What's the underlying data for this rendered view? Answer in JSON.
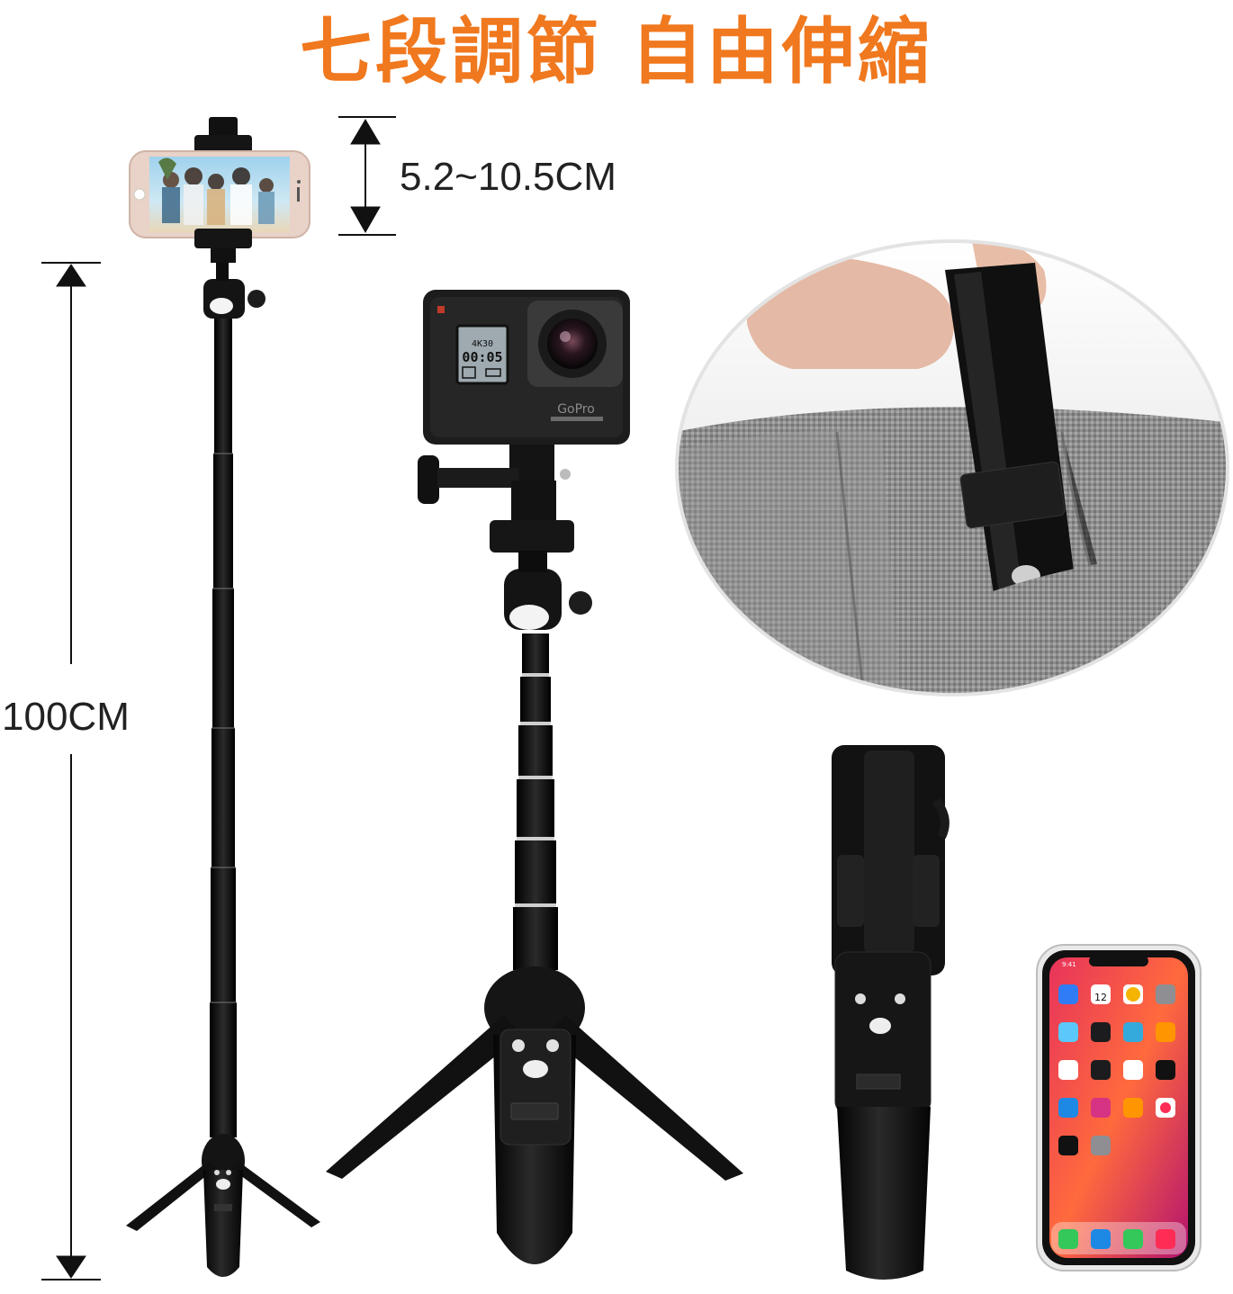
{
  "banner": {
    "title": "七段調節 自由伸縮",
    "color": "#f0781e"
  },
  "dimensions": {
    "clamp_range": "5.2~10.5CM",
    "total_length": "100CM"
  },
  "camera": {
    "brand": "GoPro",
    "screen_time": "00:05",
    "screen_mode": "4K30"
  },
  "phone": {
    "time": "9:41",
    "calendar_day": "12"
  },
  "colors": {
    "product": "#1a1a1a",
    "accent": "#f0781e"
  }
}
